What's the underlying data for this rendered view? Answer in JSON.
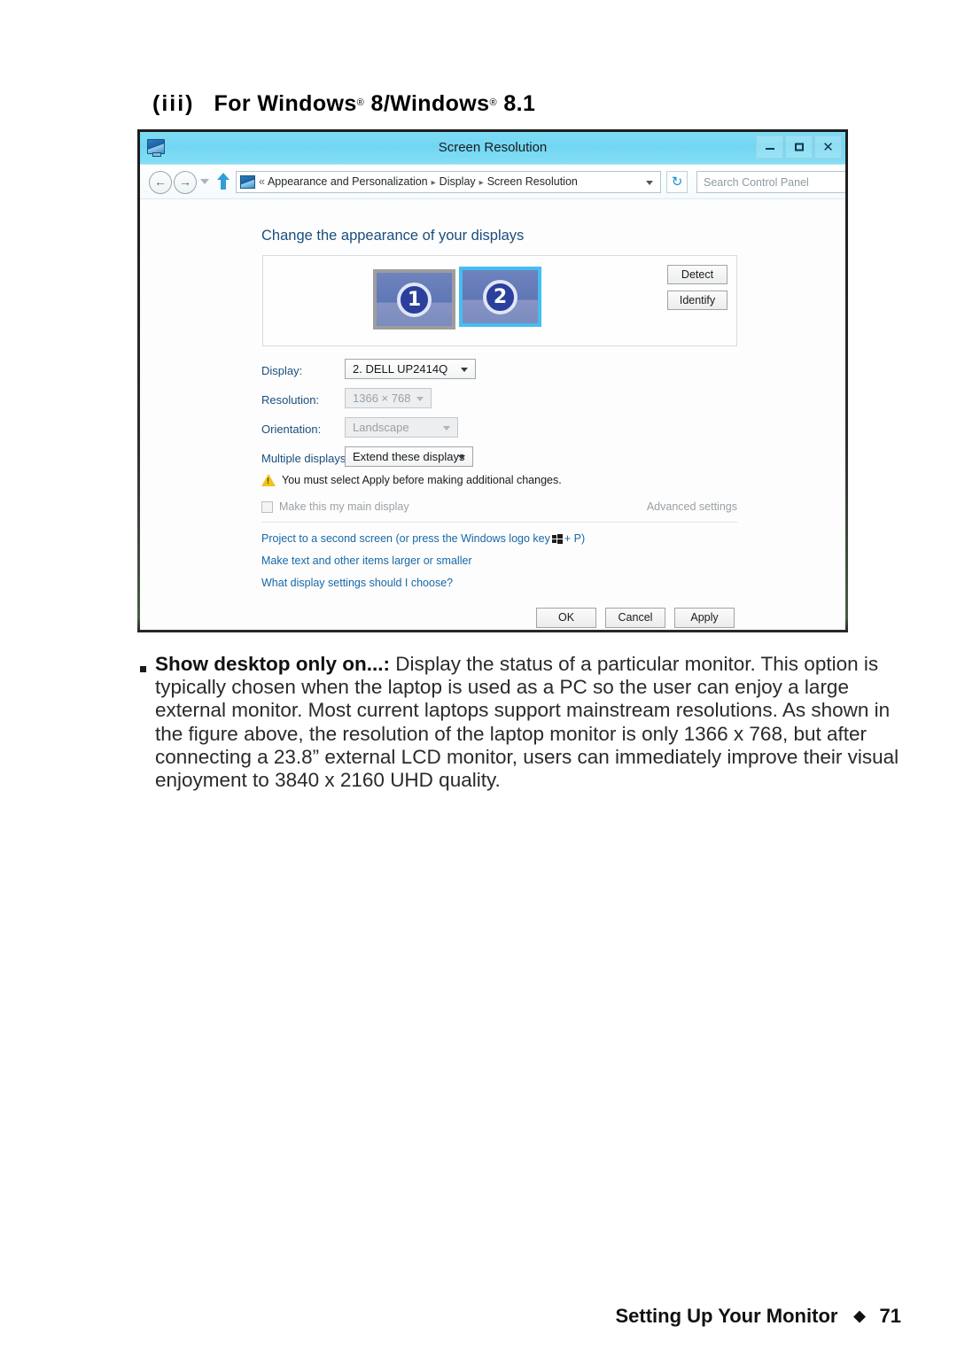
{
  "page": {
    "heading_roman": "(iii)",
    "heading_text_1": "For Windows",
    "heading_sup_1": "®",
    "heading_text_2": " 8/Windows",
    "heading_sup_2": "®",
    "heading_text_3": " 8.1"
  },
  "window": {
    "title": "Screen Resolution",
    "icon": "display-icon",
    "controls": {
      "minimize": "minimize-button",
      "maximize": "maximize-button",
      "close": "close-button"
    }
  },
  "addressbar": {
    "back": "back-arrow-icon",
    "forward": "forward-arrow-icon",
    "recent": "recent-pages-icon",
    "up": "up-one-level-icon",
    "chevron": "«",
    "crumb1": "Appearance and Personalization",
    "crumb2": "Display",
    "crumb3": "Screen Resolution",
    "separator": "▸",
    "refresh": "↻",
    "search_placeholder": "Search Control Panel"
  },
  "dialog": {
    "section_title": "Change the appearance of your displays",
    "monitors": [
      {
        "number": "1",
        "selected": false
      },
      {
        "number": "2",
        "selected": true
      }
    ],
    "detect_label": "Detect",
    "identify_label": "Identify",
    "rows": [
      {
        "label": "Display:",
        "value": "2. DELL UP2414Q",
        "disabled": false
      },
      {
        "label": "Resolution:",
        "value": "1366 × 768",
        "disabled": true
      },
      {
        "label": "Orientation:",
        "value": "Landscape",
        "disabled": true
      },
      {
        "label": "Multiple displays:",
        "value": "Extend these displays",
        "disabled": false
      }
    ],
    "warning_text": "You must select Apply before making additional changes.",
    "checkbox_label": "Make this my main display",
    "advanced_link": "Advanced settings",
    "links": [
      "Project to a second screen (or press the Windows logo key",
      "Make text and other items larger or smaller",
      "What display settings should I choose?"
    ],
    "link1_suffix": "+ P)",
    "buttons": {
      "ok": "OK",
      "cancel": "Cancel",
      "apply": "Apply"
    }
  },
  "body": {
    "bullet_bold": "Show desktop only on...:",
    "bullet_rest": " Display the status of a particular monitor. This option is typically chosen when the laptop is used as a PC so the user can enjoy a large external monitor. Most current laptops support mainstream resolutions. As shown in the figure above, the resolution of the laptop monitor is only 1366 x 768, but after connecting a 23.8” external LCD monitor, users can immediately improve their visual enjoyment to 3840 x 2160 UHD quality."
  },
  "footer": {
    "title": "Setting Up Your Monitor",
    "diamond": "◆",
    "page_number": "71"
  },
  "colors": {
    "titlebar": "#7fdcf4",
    "link": "#1668a8",
    "section_title": "#1a4e7d",
    "selected_monitor_border": "#45bdf0",
    "warning": "#f2c218"
  }
}
